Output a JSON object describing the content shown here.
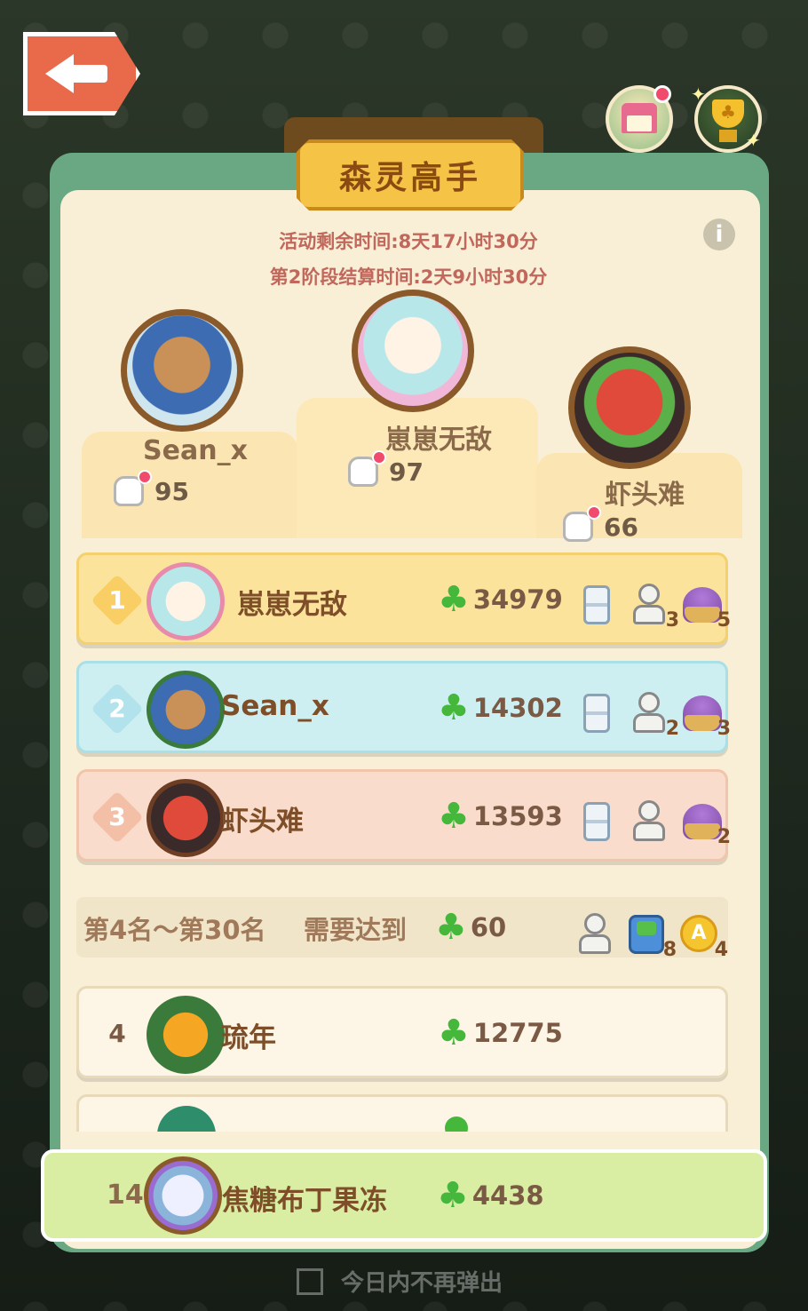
{
  "title": "森灵高手",
  "timers": {
    "activity_remaining": "活动剩余时间:8天17小时30分",
    "stage_settlement": "第2阶段结算时间:2天9小时30分"
  },
  "podium": [
    {
      "position": "second",
      "name": "Sean_x",
      "likes": "95",
      "avatar": "deer-avatar"
    },
    {
      "position": "first",
      "name": "崽崽无敌",
      "likes": "97",
      "avatar": "sheep-avatar"
    },
    {
      "position": "third",
      "name": "虾头难",
      "likes": "66",
      "avatar": "lobster-avatar"
    }
  ],
  "ranking": [
    {
      "rank": "1",
      "name": "崽崽无敌",
      "score": "34979",
      "rewards": [
        {
          "icon": "hourglass-icon",
          "count": ""
        },
        {
          "icon": "pawn-icon",
          "count": "3"
        },
        {
          "icon": "flower-basket-icon",
          "count": "5"
        }
      ]
    },
    {
      "rank": "2",
      "name": "Sean_x",
      "score": "14302",
      "rewards": [
        {
          "icon": "hourglass-icon",
          "count": ""
        },
        {
          "icon": "pawn-icon",
          "count": "2"
        },
        {
          "icon": "flower-basket-icon",
          "count": "3"
        }
      ]
    },
    {
      "rank": "3",
      "name": "虾头难",
      "score": "13593",
      "rewards": [
        {
          "icon": "hourglass-icon",
          "count": ""
        },
        {
          "icon": "pawn-icon",
          "count": ""
        },
        {
          "icon": "flower-basket-icon",
          "count": "2"
        }
      ]
    }
  ],
  "threshold": {
    "range": "第4名～第30名",
    "requirement": "需要达到",
    "score": "60",
    "rewards": [
      {
        "icon": "pawn-icon",
        "count": ""
      },
      {
        "icon": "robot-icon",
        "count": "8"
      },
      {
        "icon": "coin-icon",
        "count": "4"
      }
    ]
  },
  "others": [
    {
      "rank": "4",
      "name": "琉年",
      "score": "12775"
    }
  ],
  "me": {
    "rank": "14",
    "name": "焦糖布丁果冻",
    "score": "4438"
  },
  "dont_show_today": "今日内不再弹出",
  "colors": {
    "panel_green": "#6aa884",
    "rank1": "#fbe39c",
    "rank2": "#cdeff2",
    "rank3": "#f9dccb",
    "self_row": "#d9eea3",
    "clover": "#45b83c"
  }
}
